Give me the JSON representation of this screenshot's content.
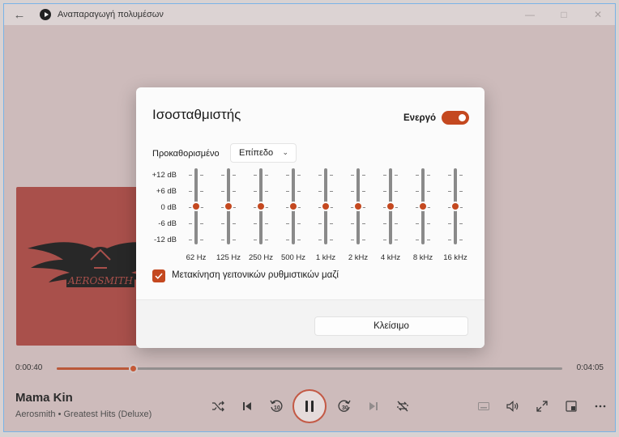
{
  "app": {
    "title": "Αναπαραγωγή πολυμέσων"
  },
  "equalizer": {
    "title": "Ισοσταθμιστής",
    "enabled_label": "Ενεργό",
    "enabled": true,
    "preset_label": "Προκαθορισμένο",
    "preset_value": "Επίπεδο",
    "db_labels": [
      "+12 dB",
      "+6 dB",
      "0 dB",
      "-6 dB",
      "-12 dB"
    ],
    "bands": [
      {
        "freq": "62 Hz",
        "gain_db": 0
      },
      {
        "freq": "125 Hz",
        "gain_db": 0
      },
      {
        "freq": "250 Hz",
        "gain_db": 0
      },
      {
        "freq": "500 Hz",
        "gain_db": 0
      },
      {
        "freq": "1 kHz",
        "gain_db": 0
      },
      {
        "freq": "2 kHz",
        "gain_db": 0
      },
      {
        "freq": "4 kHz",
        "gain_db": 0
      },
      {
        "freq": "8 kHz",
        "gain_db": 0
      },
      {
        "freq": "16 kHz",
        "gain_db": 0
      }
    ],
    "move_neighbors_label": "Μετακίνηση γειτονικών ρυθμιστικών μαζί",
    "move_neighbors_checked": true,
    "close_label": "Κλείσιμο"
  },
  "player": {
    "current_time": "0:00:40",
    "total_time": "0:04:05",
    "progress_fraction": 0.15,
    "song_title": "Mama Kin",
    "song_subtitle": "Aerosmith • Greatest Hits (Deluxe)",
    "skip_back_seconds": "10",
    "skip_forward_seconds": "30"
  },
  "colors": {
    "accent": "#c4481f",
    "album_art": "#a5453f"
  }
}
